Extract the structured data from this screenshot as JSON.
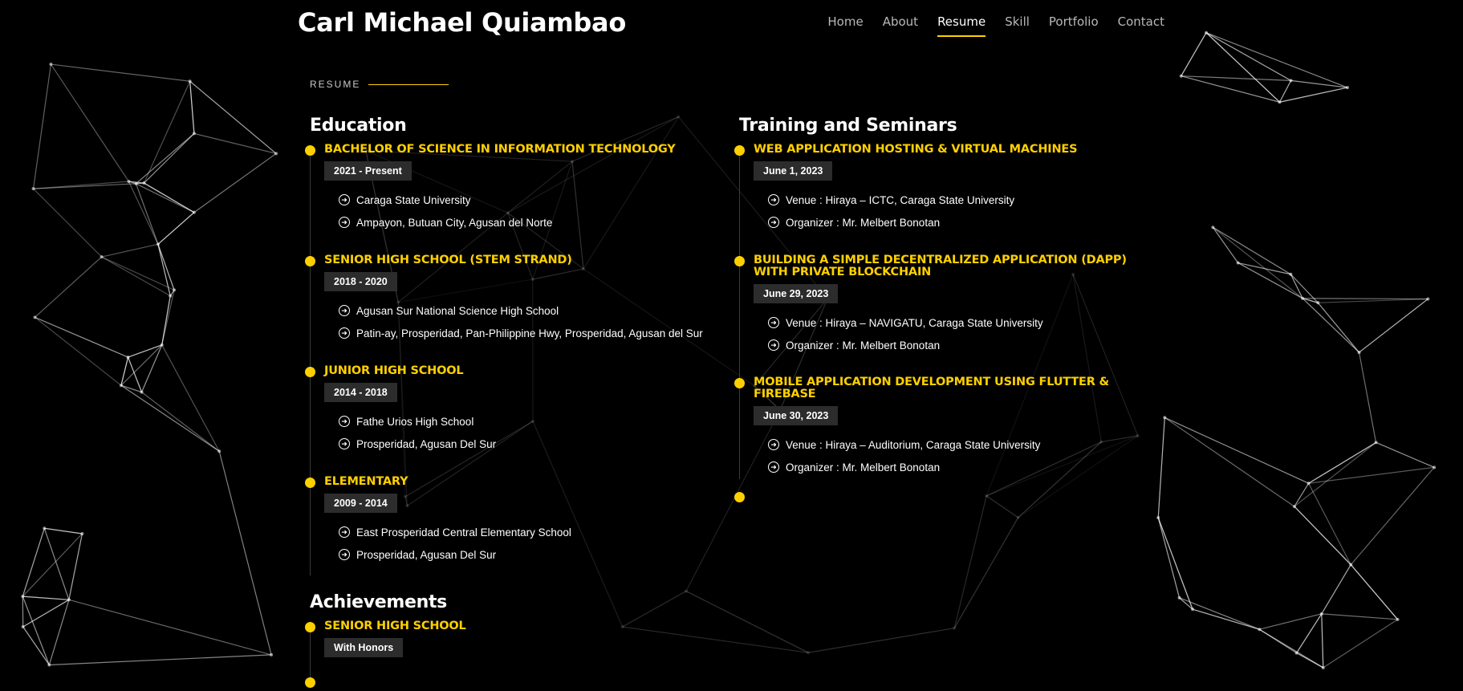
{
  "header": {
    "logo": "Carl Michael Quiambao",
    "nav": [
      "Home",
      "About",
      "Resume",
      "Skill",
      "Portfolio",
      "Contact"
    ],
    "active_nav": "Resume"
  },
  "section_label": "RESUME",
  "education": {
    "title": "Education",
    "items": [
      {
        "title": "BACHELOR OF SCIENCE IN INFORMATION TECHNOLOGY",
        "date": "2021 - Present",
        "details": [
          "Caraga State University",
          "Ampayon, Butuan City, Agusan del Norte"
        ]
      },
      {
        "title": "SENIOR HIGH SCHOOL (STEM STRAND)",
        "date": "2018 - 2020",
        "details": [
          "Agusan Sur National Science High School",
          "Patin-ay, Prosperidad, Pan-Philippine Hwy, Prosperidad, Agusan del Sur"
        ]
      },
      {
        "title": "JUNIOR HIGH SCHOOL",
        "date": "2014 - 2018",
        "details": [
          "Fathe Urios High School",
          "Prosperidad, Agusan Del Sur"
        ]
      },
      {
        "title": "ELEMENTARY",
        "date": "2009 - 2014",
        "details": [
          "East Prosperidad Central Elementary School",
          "Prosperidad, Agusan Del Sur"
        ]
      }
    ]
  },
  "achievements": {
    "title": "Achievements",
    "items": [
      {
        "title": "SENIOR HIGH SCHOOL",
        "date": "With Honors"
      }
    ]
  },
  "training": {
    "title": "Training and Seminars",
    "items": [
      {
        "title": "WEB APPLICATION HOSTING & VIRTUAL MACHINES",
        "date": "June 1, 2023",
        "details": [
          "Venue : Hiraya – ICTC, Caraga State University",
          "Organizer : Mr. Melbert Bonotan"
        ]
      },
      {
        "title": "BUILDING A SIMPLE DECENTRALIZED APPLICATION (DAPP) WITH PRIVATE BLOCKCHAIN",
        "date": "June 29, 2023",
        "details": [
          "Venue : Hiraya – NAVIGATU, Caraga State University",
          "Organizer : Mr. Melbert Bonotan"
        ]
      },
      {
        "title": "MOBILE APPLICATION DEVELOPMENT USING FLUTTER & FIREBASE",
        "date": "June 30, 2023",
        "details": [
          "Venue : Hiraya – Auditorium, Caraga State University",
          "Organizer : Mr. Melbert Bonotan"
        ]
      }
    ]
  },
  "colors": {
    "accent": "#ffd000",
    "background": "#000000",
    "badge": "#2c2c2c"
  },
  "icons": {
    "detail_bullet": "arrow-circle-right-icon"
  }
}
